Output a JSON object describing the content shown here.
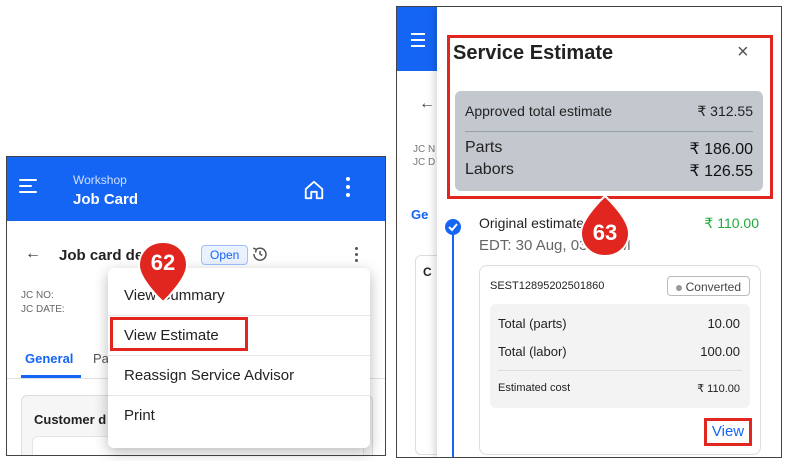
{
  "left": {
    "header": {
      "subtitle": "Workshop",
      "title": "Job Card"
    },
    "page_title": "Job card details",
    "status_badge": "Open",
    "jc_no_label": "JC NO:",
    "jc_date_label": "JC DATE:",
    "tabs": [
      "General",
      "Pa"
    ],
    "customer_label": "Customer d",
    "menu": [
      "View Summary",
      "View Estimate",
      "Reassign Service Advisor",
      "Print"
    ],
    "marker": "62"
  },
  "right": {
    "bg": {
      "jc_n": "JC N",
      "jc_d": "JC D",
      "gen": "Ge",
      "c": "C"
    },
    "sheet_title": "Service Estimate",
    "close": "×",
    "summary": {
      "approved_label": "Approved total estimate",
      "approved_value": "₹ 312.55",
      "parts_label": "Parts",
      "parts_value": "₹ 186.00",
      "labors_label": "Labors",
      "labors_value": "₹ 126.55"
    },
    "estimate": {
      "title": "Original estimate",
      "amount": "₹ 110.00",
      "date": "EDT: 30 Aug, 03:15PM",
      "code": "SEST12895202501860",
      "status": "Converted",
      "parts_label": "Total (parts)",
      "parts_value": "10.00",
      "labor_label": "Total (labor)",
      "labor_value": "100.00",
      "cost_label": "Estimated cost",
      "cost_value": "₹ 110.00",
      "view_label": "View"
    },
    "marker": "63"
  },
  "colors": {
    "primary": "#1565f5",
    "highlight": "#e0261f",
    "marker": "#e0261f",
    "success": "#1faa3a",
    "summary_bg": "#c3c8cf"
  }
}
